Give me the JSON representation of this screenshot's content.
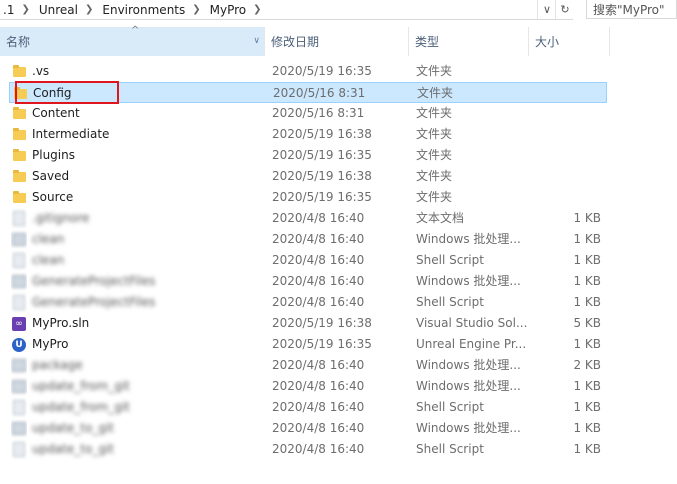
{
  "address": {
    "crumbs": [
      ".1",
      "Unreal",
      "Environments",
      "MyPro"
    ],
    "search_placeholder": "搜索\"MyPro\""
  },
  "columns": {
    "name": "名称",
    "date": "修改日期",
    "type": "类型",
    "size": "大小"
  },
  "rows": [
    {
      "name": ".vs",
      "date": "2020/5/19 16:35",
      "type": "文件夹",
      "size": "",
      "icon": "folder-icon"
    },
    {
      "name": "Config",
      "date": "2020/5/16 8:31",
      "type": "文件夹",
      "size": "",
      "icon": "folder-icon"
    },
    {
      "name": "Content",
      "date": "2020/5/16 8:31",
      "type": "文件夹",
      "size": "",
      "icon": "folder-icon"
    },
    {
      "name": "Intermediate",
      "date": "2020/5/19 16:38",
      "type": "文件夹",
      "size": "",
      "icon": "folder-icon"
    },
    {
      "name": "Plugins",
      "date": "2020/5/19 16:35",
      "type": "文件夹",
      "size": "",
      "icon": "folder-icon"
    },
    {
      "name": "Saved",
      "date": "2020/5/19 16:38",
      "type": "文件夹",
      "size": "",
      "icon": "folder-icon"
    },
    {
      "name": "Source",
      "date": "2020/5/19 16:35",
      "type": "文件夹",
      "size": "",
      "icon": "folder-icon"
    },
    {
      "name": ".gitignore",
      "date": "2020/4/8 16:40",
      "type": "文本文档",
      "size": "1 KB",
      "icon": "text-file-icon"
    },
    {
      "name": "clean",
      "date": "2020/4/8 16:40",
      "type": "Windows 批处理...",
      "size": "1 KB",
      "icon": "batch-file-icon"
    },
    {
      "name": "clean",
      "date": "2020/4/8 16:40",
      "type": "Shell Script",
      "size": "1 KB",
      "icon": "script-file-icon"
    },
    {
      "name": "GenerateProjectFiles",
      "date": "2020/4/8 16:40",
      "type": "Windows 批处理...",
      "size": "1 KB",
      "icon": "batch-file-icon"
    },
    {
      "name": "GenerateProjectFiles",
      "date": "2020/4/8 16:40",
      "type": "Shell Script",
      "size": "1 KB",
      "icon": "script-file-icon"
    },
    {
      "name": "MyPro.sln",
      "date": "2020/5/19 16:38",
      "type": "Visual Studio Sol...",
      "size": "5 KB",
      "icon": "visual-studio-icon"
    },
    {
      "name": "MyPro",
      "date": "2020/5/19 16:35",
      "type": "Unreal Engine Pr...",
      "size": "1 KB",
      "icon": "unreal-engine-icon"
    },
    {
      "name": "package",
      "date": "2020/4/8 16:40",
      "type": "Windows 批处理...",
      "size": "2 KB",
      "icon": "batch-file-icon"
    },
    {
      "name": "update_from_git",
      "date": "2020/4/8 16:40",
      "type": "Windows 批处理...",
      "size": "1 KB",
      "icon": "batch-file-icon"
    },
    {
      "name": "update_from_git",
      "date": "2020/4/8 16:40",
      "type": "Shell Script",
      "size": "1 KB",
      "icon": "script-file-icon"
    },
    {
      "name": "update_to_git",
      "date": "2020/4/8 16:40",
      "type": "Windows 批处理...",
      "size": "1 KB",
      "icon": "batch-file-icon"
    },
    {
      "name": "update_to_git",
      "date": "2020/4/8 16:40",
      "type": "Shell Script",
      "size": "1 KB",
      "icon": "script-file-icon"
    }
  ]
}
